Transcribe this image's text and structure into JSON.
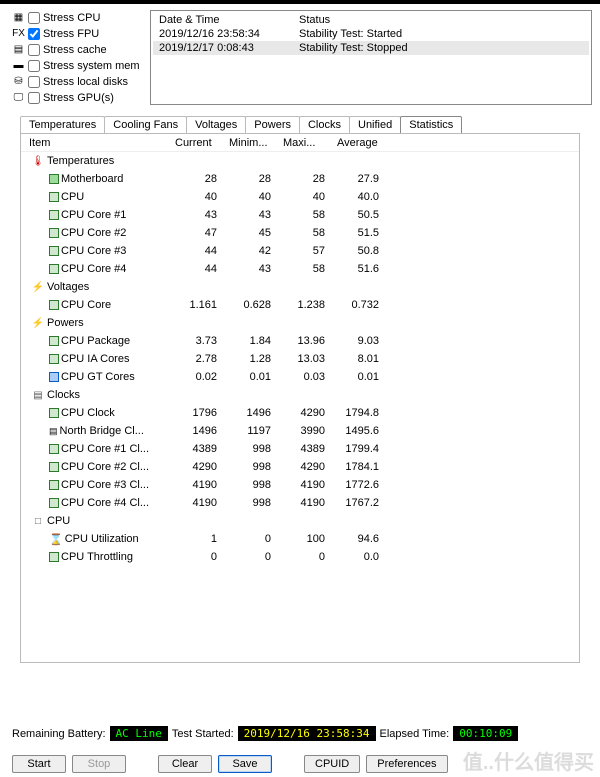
{
  "stress": {
    "items": [
      {
        "label": "Stress CPU",
        "checked": false,
        "icon": "▦"
      },
      {
        "label": "Stress FPU",
        "checked": true,
        "icon": "FX"
      },
      {
        "label": "Stress cache",
        "checked": false,
        "icon": "▤"
      },
      {
        "label": "Stress system mem",
        "checked": false,
        "icon": "▬"
      },
      {
        "label": "Stress local disks",
        "checked": false,
        "icon": "⛁"
      },
      {
        "label": "Stress GPU(s)",
        "checked": false,
        "icon": "🖵"
      }
    ]
  },
  "log": {
    "headers": {
      "c1": "Date & Time",
      "c2": "Status"
    },
    "rows": [
      {
        "c1": "2019/12/16 23:58:34",
        "c2": "Stability Test: Started",
        "sel": false
      },
      {
        "c1": "2019/12/17 0:08:43",
        "c2": "Stability Test: Stopped",
        "sel": true
      }
    ]
  },
  "tabs": [
    "Temperatures",
    "Cooling Fans",
    "Voltages",
    "Powers",
    "Clocks",
    "Unified",
    "Statistics"
  ],
  "active_tab": "Statistics",
  "table": {
    "headers": {
      "item": "Item",
      "cur": "Current",
      "min": "Minim...",
      "max": "Maxi...",
      "avg": "Average"
    },
    "groups": [
      {
        "name": "Temperatures",
        "icon": "🌡",
        "rows": [
          {
            "name": "Motherboard",
            "ico": "mb",
            "cur": "28",
            "min": "28",
            "max": "28",
            "avg": "27.9"
          },
          {
            "name": "CPU",
            "ico": "sq",
            "cur": "40",
            "min": "40",
            "max": "40",
            "avg": "40.0"
          },
          {
            "name": "CPU Core #1",
            "ico": "sq",
            "cur": "43",
            "min": "43",
            "max": "58",
            "avg": "50.5"
          },
          {
            "name": "CPU Core #2",
            "ico": "sq",
            "cur": "47",
            "min": "45",
            "max": "58",
            "avg": "51.5"
          },
          {
            "name": "CPU Core #3",
            "ico": "sq",
            "cur": "44",
            "min": "42",
            "max": "57",
            "avg": "50.8"
          },
          {
            "name": "CPU Core #4",
            "ico": "sq",
            "cur": "44",
            "min": "43",
            "max": "58",
            "avg": "51.6"
          }
        ]
      },
      {
        "name": "Voltages",
        "icon": "⚡",
        "rows": [
          {
            "name": "CPU Core",
            "ico": "sq",
            "cur": "1.161",
            "min": "0.628",
            "max": "1.238",
            "avg": "0.732"
          }
        ]
      },
      {
        "name": "Powers",
        "icon": "⚡",
        "rows": [
          {
            "name": "CPU Package",
            "ico": "sq",
            "cur": "3.73",
            "min": "1.84",
            "max": "13.96",
            "avg": "9.03"
          },
          {
            "name": "CPU IA Cores",
            "ico": "sq",
            "cur": "2.78",
            "min": "1.28",
            "max": "13.03",
            "avg": "8.01"
          },
          {
            "name": "CPU GT Cores",
            "ico": "gt",
            "cur": "0.02",
            "min": "0.01",
            "max": "0.03",
            "avg": "0.01"
          }
        ]
      },
      {
        "name": "Clocks",
        "icon": "▤",
        "rows": [
          {
            "name": "CPU Clock",
            "ico": "sq",
            "cur": "1796",
            "min": "1496",
            "max": "4290",
            "avg": "1794.8"
          },
          {
            "name": "North Bridge Cl...",
            "ico": "nb",
            "cur": "1496",
            "min": "1197",
            "max": "3990",
            "avg": "1495.6"
          },
          {
            "name": "CPU Core #1 Cl...",
            "ico": "sq",
            "cur": "4389",
            "min": "998",
            "max": "4389",
            "avg": "1799.4"
          },
          {
            "name": "CPU Core #2 Cl...",
            "ico": "sq",
            "cur": "4290",
            "min": "998",
            "max": "4290",
            "avg": "1784.1"
          },
          {
            "name": "CPU Core #3 Cl...",
            "ico": "sq",
            "cur": "4190",
            "min": "998",
            "max": "4190",
            "avg": "1772.6"
          },
          {
            "name": "CPU Core #4 Cl...",
            "ico": "sq",
            "cur": "4190",
            "min": "998",
            "max": "4190",
            "avg": "1767.2"
          }
        ]
      },
      {
        "name": "CPU",
        "icon": "□",
        "rows": [
          {
            "name": "CPU Utilization",
            "ico": "hr",
            "cur": "1",
            "min": "0",
            "max": "100",
            "avg": "94.6"
          },
          {
            "name": "CPU Throttling",
            "ico": "sq",
            "cur": "0",
            "min": "0",
            "max": "0",
            "avg": "0.0"
          }
        ]
      }
    ]
  },
  "status": {
    "battery_label": "Remaining Battery:",
    "battery_val": "AC Line",
    "started_label": "Test Started:",
    "started_val": "2019/12/16 23:58:34",
    "elapsed_label": "Elapsed Time:",
    "elapsed_val": "00:10:09"
  },
  "buttons": {
    "start": "Start",
    "stop": "Stop",
    "clear": "Clear",
    "save": "Save",
    "cpuid": "CPUID",
    "prefs": "Preferences"
  },
  "watermark": "值..什么值得买"
}
